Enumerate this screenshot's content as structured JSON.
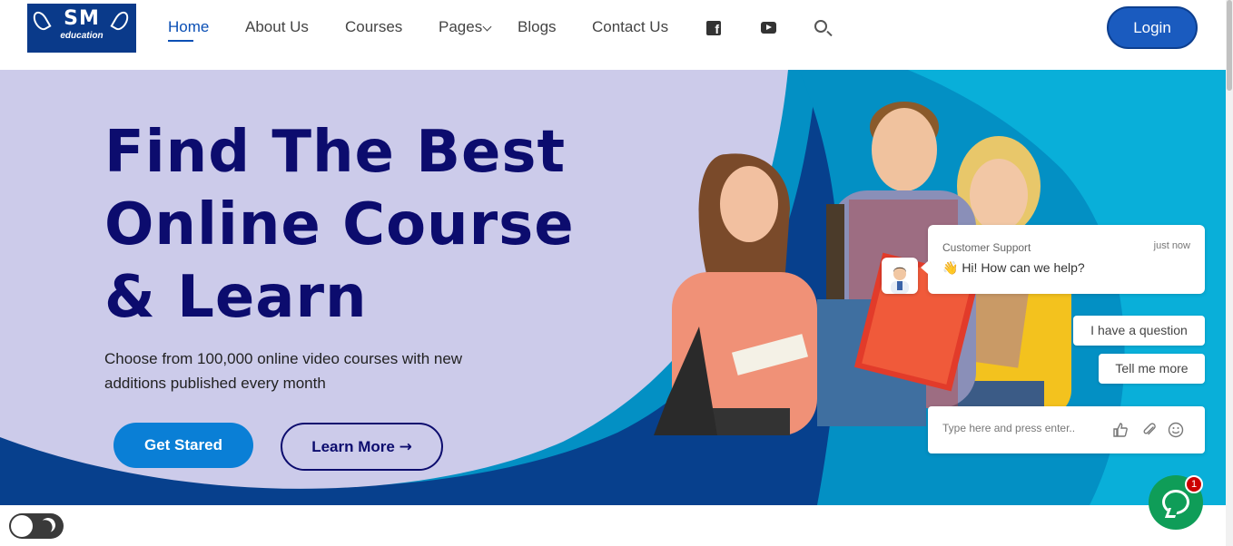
{
  "brand": {
    "logo_mark": "SM",
    "logo_sub": "education"
  },
  "nav": {
    "items": [
      {
        "label": "Home",
        "active": true
      },
      {
        "label": "About Us"
      },
      {
        "label": "Courses"
      },
      {
        "label": "Pages",
        "dropdown": true
      },
      {
        "label": "Blogs"
      },
      {
        "label": "Contact Us"
      }
    ],
    "icons": [
      "facebook-icon",
      "youtube-icon",
      "search-icon"
    ],
    "login_label": "Login"
  },
  "hero": {
    "title_line1": "Find The Best",
    "title_line2": "Online Course",
    "title_line3": "& Learn",
    "subtitle": "Choose from 100,000 online video courses with  new additions published every month",
    "primary_button": "Get Stared",
    "secondary_button": "Learn More"
  },
  "chat": {
    "agent": "Customer Support",
    "time": "just now",
    "message": "👋 Hi! How can we help?",
    "quick_replies": [
      "I have a question",
      "Tell me more"
    ],
    "input_placeholder": "Type here and press enter..",
    "badge_count": "1"
  },
  "theme_toggle": {
    "icon": "moon-icon"
  },
  "colors": {
    "accent": "#1a5bbf",
    "hero_lavender": "#cccbea",
    "hero_title": "#0c0c6e",
    "hero_cyan": "#0390c4",
    "chat_green": "#0f9d58"
  }
}
